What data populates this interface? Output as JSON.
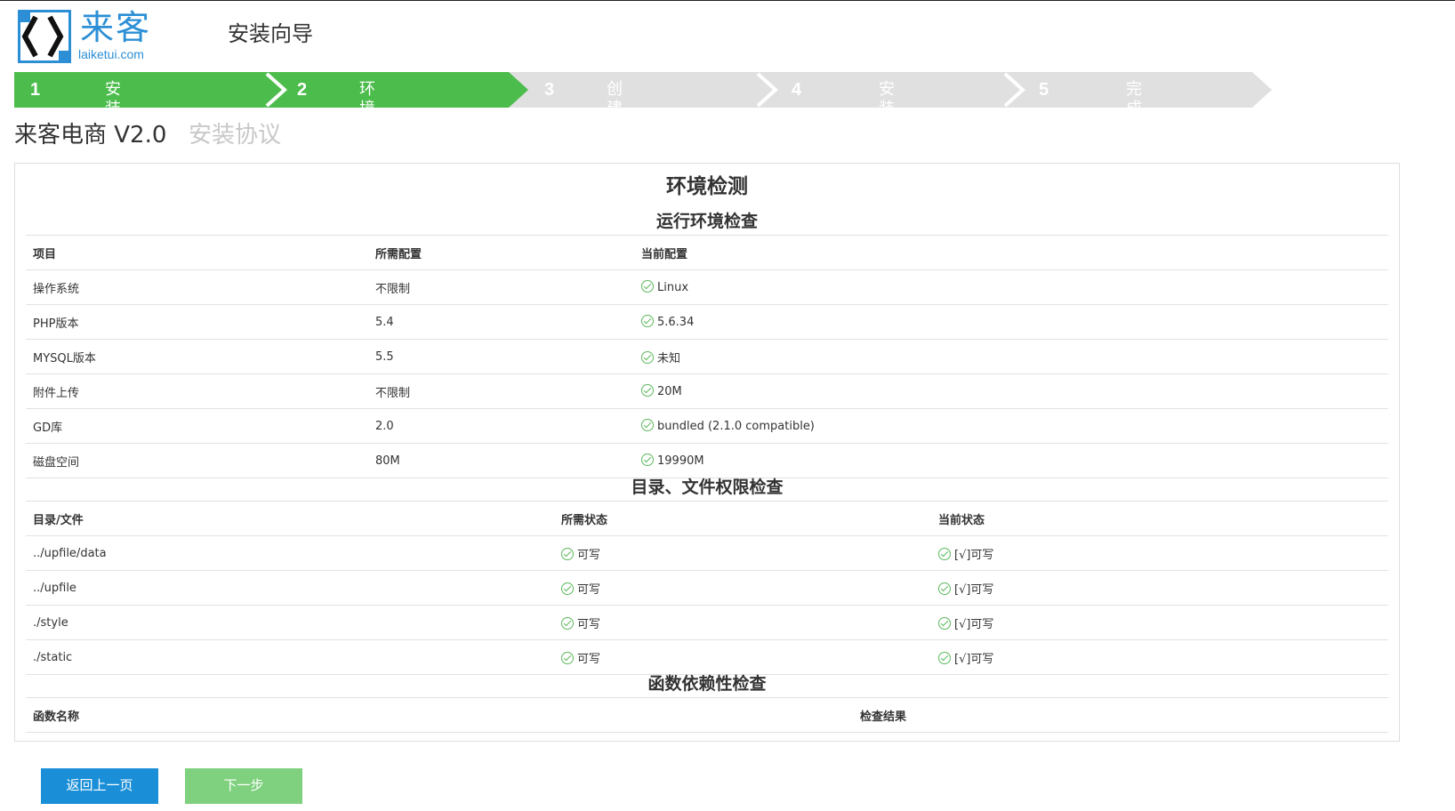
{
  "header": {
    "logo_cn": "来客",
    "logo_en": "laiketui.com",
    "wizard_title": "安装向导"
  },
  "steps": [
    {
      "num": "1",
      "label": "安装协议",
      "state": "done"
    },
    {
      "num": "2",
      "label": "环境检测",
      "state": "active"
    },
    {
      "num": "3",
      "label": "创建数据库",
      "state": "pending"
    },
    {
      "num": "4",
      "label": "安装",
      "state": "pending"
    },
    {
      "num": "5",
      "label": "完成",
      "state": "pending"
    }
  ],
  "colors": {
    "step_done": "#4cbd4c",
    "step_pending": "#e0e0e0",
    "accent": "#1a8fd8",
    "ok": "#5cb85c"
  },
  "product": {
    "title": "来客电商 V2.0",
    "subtitle": "安装协议"
  },
  "panel": {
    "title": "环境检测",
    "env": {
      "title": "运行环境检查",
      "headers": [
        "项目",
        "所需配置",
        "当前配置"
      ],
      "rows": [
        [
          "操作系统",
          "不限制",
          "Linux"
        ],
        [
          "PHP版本",
          "5.4",
          "5.6.34"
        ],
        [
          "MYSQL版本",
          "5.5",
          "未知"
        ],
        [
          "附件上传",
          "不限制",
          "20M"
        ],
        [
          "GD库",
          "2.0",
          "bundled (2.1.0 compatible)"
        ],
        [
          "磁盘空间",
          "80M",
          "19990M"
        ]
      ]
    },
    "perm": {
      "title": "目录、文件权限检查",
      "headers": [
        "目录/文件",
        "所需状态",
        "当前状态"
      ],
      "rows": [
        [
          "../upfile/data",
          "可写",
          "[√]可写"
        ],
        [
          "../upfile",
          "可写",
          "[√]可写"
        ],
        [
          "./style",
          "可写",
          "[√]可写"
        ],
        [
          "./static",
          "可写",
          "[√]可写"
        ]
      ]
    },
    "func": {
      "title": "函数依赖性检查",
      "headers": [
        "函数名称",
        "检查结果"
      ]
    }
  },
  "buttons": {
    "back": "返回上一页",
    "next": "下一步"
  }
}
